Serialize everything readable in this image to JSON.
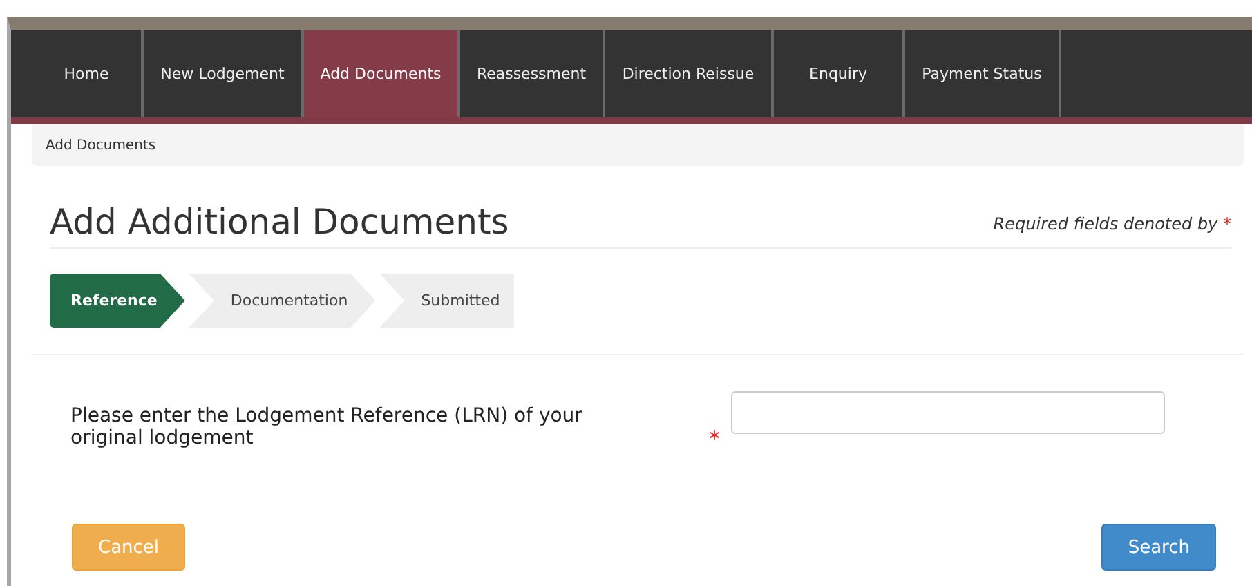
{
  "nav": {
    "tabs": [
      {
        "label": "Home",
        "selected": false
      },
      {
        "label": "New Lodgement",
        "selected": false
      },
      {
        "label": "Add Documents",
        "selected": true
      },
      {
        "label": "Reassessment",
        "selected": false
      },
      {
        "label": "Direction Reissue",
        "selected": false
      },
      {
        "label": "Enquiry",
        "selected": false
      },
      {
        "label": "Payment Status",
        "selected": false
      }
    ]
  },
  "breadcrumb": "Add Documents",
  "title": "Add Additional Documents",
  "required_note": {
    "text": "Required fields denoted by",
    "marker": "*"
  },
  "steps": [
    {
      "label": "Reference",
      "selected": true
    },
    {
      "label": "Documentation",
      "selected": false
    },
    {
      "label": "Submitted",
      "selected": false
    }
  ],
  "field": {
    "label": "Please enter the Lodgement Reference (LRN) of your original lodgement",
    "required_marker": "*"
  },
  "buttons": [
    {
      "label": "Cancel",
      "kind": "warning"
    },
    {
      "label": "Search",
      "kind": "primary"
    }
  ]
}
